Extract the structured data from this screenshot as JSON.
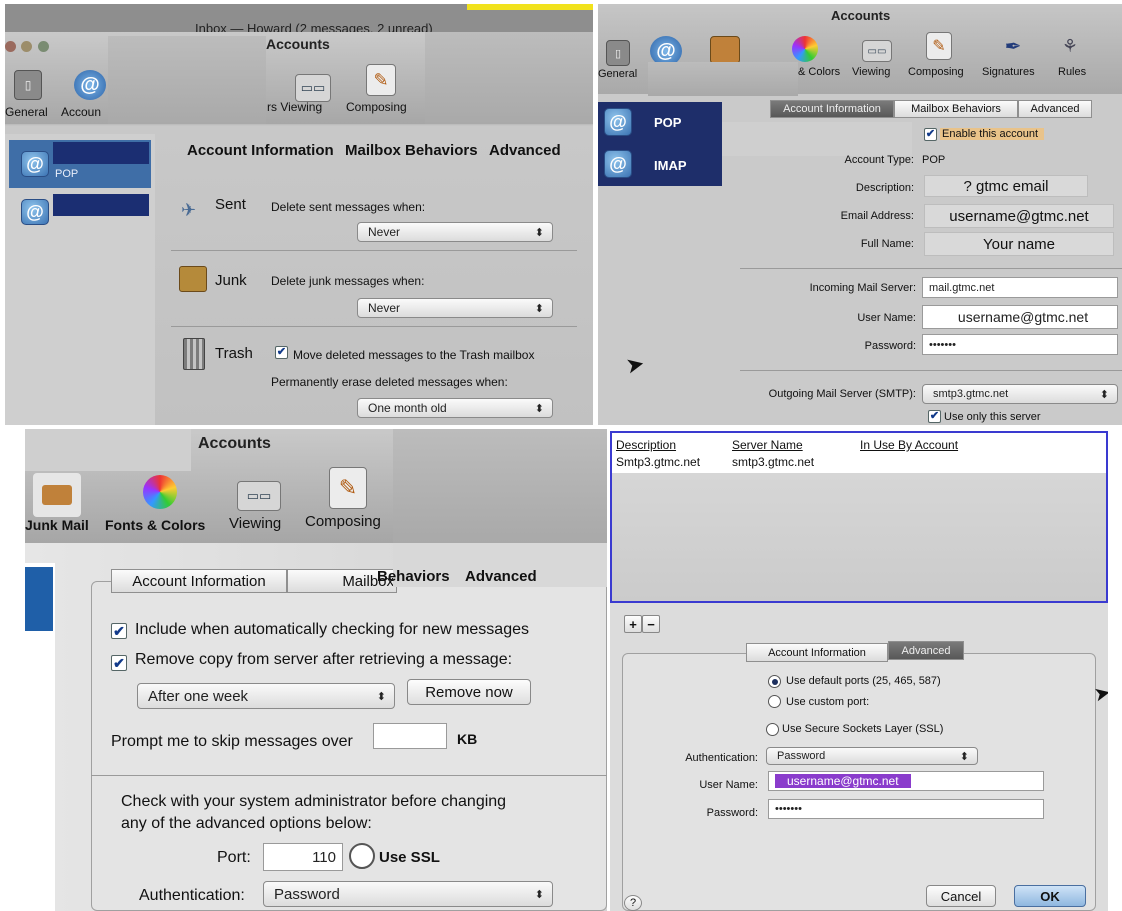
{
  "q1": {
    "window_title_fragment": "Inbox — Howard (2 messages, 2 unread)",
    "title": "Accounts",
    "toolbar": {
      "general": "General",
      "accounts_fragment": "Accoun",
      "viewing_fragment": "rs Viewing",
      "composing": "Composing"
    },
    "accounts": [
      {
        "type_label": "POP"
      }
    ],
    "tabs": {
      "info": "Account Information",
      "mailbox": "Mailbox Behaviors",
      "advanced": "Advanced"
    },
    "sent": {
      "label": "Sent",
      "prompt": "Delete sent messages when:",
      "value": "Never"
    },
    "junk": {
      "label": "Junk",
      "prompt": "Delete junk messages when:",
      "value": "Never"
    },
    "trash": {
      "label": "Trash",
      "move_label": "Move deleted messages to the Trash mailbox",
      "move_checked": true,
      "erase_prompt": "Permanently erase deleted messages when:",
      "value": "One month old"
    }
  },
  "q2": {
    "title": "Accounts",
    "toolbar": {
      "general_fragment": "General",
      "fonts_fragment": "& Colors",
      "viewing": "Viewing",
      "composing": "Composing",
      "signatures": "Signatures",
      "rules": "Rules"
    },
    "accounts": [
      {
        "label": "POP"
      },
      {
        "label": "IMAP"
      }
    ],
    "tabs": {
      "info": "Account Information",
      "mailbox": "Mailbox Behaviors",
      "advanced": "Advanced"
    },
    "enable_label": "Enable this account",
    "enable_checked": true,
    "account_type_label": "Account Type:",
    "account_type_value": "POP",
    "description_label": "Description:",
    "description_value": "? gtmc email",
    "email_label": "Email Address:",
    "email_value": "username@gtmc.net",
    "fullname_label": "Full Name:",
    "fullname_value": "Your name",
    "incoming_label": "Incoming Mail Server:",
    "incoming_value": "mail.gtmc.net",
    "username_label": "User Name:",
    "username_value": "username@gtmc.net",
    "password_label": "Password:",
    "password_value": "•••••••",
    "smtp_label": "Outgoing Mail Server (SMTP):",
    "smtp_value": "smtp3.gtmc.net",
    "only_server_label": "Use only this server",
    "only_server_checked": true
  },
  "q3": {
    "title": "Accounts",
    "toolbar": {
      "junk": "Junk Mail",
      "fonts": "Fonts & Colors",
      "viewing": "Viewing",
      "composing": "Composing"
    },
    "tabs": {
      "info": "Account Information",
      "mailbox_a": "Mailbox ",
      "mailbox_b": "Behaviors",
      "advanced": "Advanced"
    },
    "include_label": "Include when automatically checking for new messages",
    "include_checked": true,
    "remove_label": "Remove copy from server after retrieving a message:",
    "remove_checked": true,
    "remove_value": "After one week",
    "remove_now": "Remove now",
    "prompt_label": "Prompt me to skip messages over",
    "prompt_value": "",
    "kb": "KB",
    "admin_note_1": "Check with your system administrator before changing",
    "admin_note_2": "any of the advanced options below:",
    "port_label": "Port:",
    "port_value": "110",
    "use_ssl": "Use SSL",
    "auth_label": "Authentication:",
    "auth_value": "Password"
  },
  "q4": {
    "columns": {
      "description": "Description",
      "server": "Server Name",
      "inuse": "In Use By Account"
    },
    "rows": [
      {
        "description": "Smtp3.gtmc.net",
        "server": "smtp3.gtmc.net",
        "inuse": ""
      }
    ],
    "plus": "+",
    "minus": "−",
    "tabs": {
      "info": "Account Information",
      "advanced": "Advanced"
    },
    "default_ports": "Use default ports (25, 465, 587)",
    "custom_port": "Use custom port:",
    "ssl": "Use Secure Sockets Layer (SSL)",
    "auth_label": "Authentication:",
    "auth_value": "Password",
    "username_label": "User Name:",
    "username_value": "username@gtmc.net",
    "password_label": "Password:",
    "password_value": "•••••••",
    "help": "?",
    "cancel": "Cancel",
    "ok": "OK"
  }
}
